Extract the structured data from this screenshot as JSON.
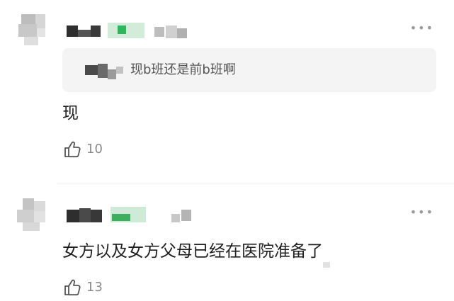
{
  "comments": [
    {
      "quote": "现b班还是前b班啊",
      "text": "现",
      "like_count": "10",
      "more": "•••"
    },
    {
      "text": "女方以及女方父母已经在医院准备了",
      "like_count": "13",
      "more": "•••"
    }
  ],
  "colors": {
    "name_badge_green": "#2fb55a",
    "name_badge_light": "#cdebd6",
    "quote_bg": "#f4f4f4"
  },
  "icons": {
    "like": "thumbs-up-icon",
    "more": "more-dots-icon"
  }
}
